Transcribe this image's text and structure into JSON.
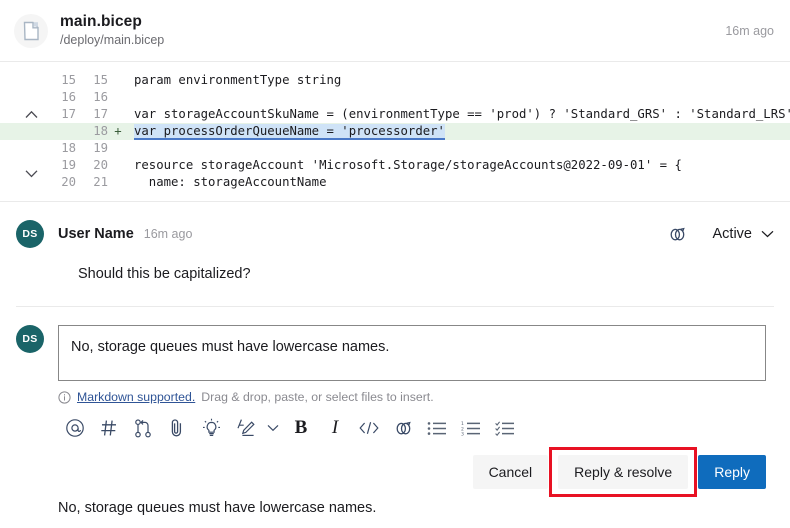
{
  "header": {
    "file_icon": "file-icon",
    "file_name": "main.bicep",
    "file_path": "/deploy/main.bicep",
    "time": "16m ago"
  },
  "diff": {
    "collapse_up_icon": "chevron-up-icon",
    "collapse_down_icon": "chevron-down-icon",
    "rows": [
      {
        "old": "15",
        "new": "15",
        "sign": "",
        "code": "param environmentType string",
        "type": "context"
      },
      {
        "old": "16",
        "new": "16",
        "sign": "",
        "code": "",
        "type": "context"
      },
      {
        "old": "17",
        "new": "17",
        "sign": "",
        "code": "var storageAccountSkuName = (environmentType == 'prod') ? 'Standard_GRS' : 'Standard_LRS'",
        "type": "context"
      },
      {
        "old": "",
        "new": "18",
        "sign": "+",
        "code": "var processOrderQueueName = 'processorder'",
        "type": "added",
        "selected": "var processOrderQueueName = 'processorder'"
      },
      {
        "old": "18",
        "new": "19",
        "sign": "",
        "code": "",
        "type": "context"
      },
      {
        "old": "19",
        "new": "20",
        "sign": "",
        "code": "resource storageAccount 'Microsoft.Storage/storageAccounts@2022-09-01' = {",
        "type": "context"
      },
      {
        "old": "20",
        "new": "21",
        "sign": "",
        "code": "  name: storageAccountName",
        "type": "context"
      }
    ]
  },
  "comment": {
    "avatar_initials": "DS",
    "author": "User Name",
    "time": "16m ago",
    "link_icon": "link-icon",
    "status_label": "Active",
    "status_chevron": "chevron-down-icon",
    "body": "Should this be capitalized?"
  },
  "reply": {
    "avatar_initials": "DS",
    "value": "No, storage queues must have lowercase names.",
    "placeholder": "",
    "hint_icon": "info-icon",
    "hint_link": "Markdown supported.",
    "hint_text": "Drag & drop, paste, or select files to insert.",
    "toolbar": [
      {
        "name": "mention-icon",
        "glyph": "@"
      },
      {
        "name": "work-item-icon",
        "glyph": "#"
      },
      {
        "name": "pull-request-icon",
        "glyph": ""
      },
      {
        "name": "attach-icon",
        "glyph": ""
      },
      {
        "name": "suggestion-icon",
        "glyph": ""
      },
      {
        "name": "highlight-pen-icon",
        "glyph": ""
      },
      {
        "name": "chevron-down-icon",
        "glyph": ""
      },
      {
        "name": "bold-icon",
        "glyph": "B"
      },
      {
        "name": "italic-icon",
        "glyph": "I"
      },
      {
        "name": "code-icon",
        "glyph": ""
      },
      {
        "name": "link-icon",
        "glyph": ""
      },
      {
        "name": "bulleted-list-icon",
        "glyph": ""
      },
      {
        "name": "numbered-list-icon",
        "glyph": ""
      },
      {
        "name": "task-list-icon",
        "glyph": ""
      }
    ],
    "cancel_label": "Cancel",
    "reply_resolve_label": "Reply & resolve",
    "reply_label": "Reply"
  },
  "bottom_text": "No, storage queues must have lowercase names.",
  "colors": {
    "accent_blue": "#0f6cbd",
    "avatar_teal": "#1a6468",
    "added_line_bg": "#e7f3e7",
    "selection_bg": "#cfe3f7",
    "selection_underline": "#4a79c7",
    "annotation_red": "#e81123",
    "link_blue": "#2f5496"
  }
}
